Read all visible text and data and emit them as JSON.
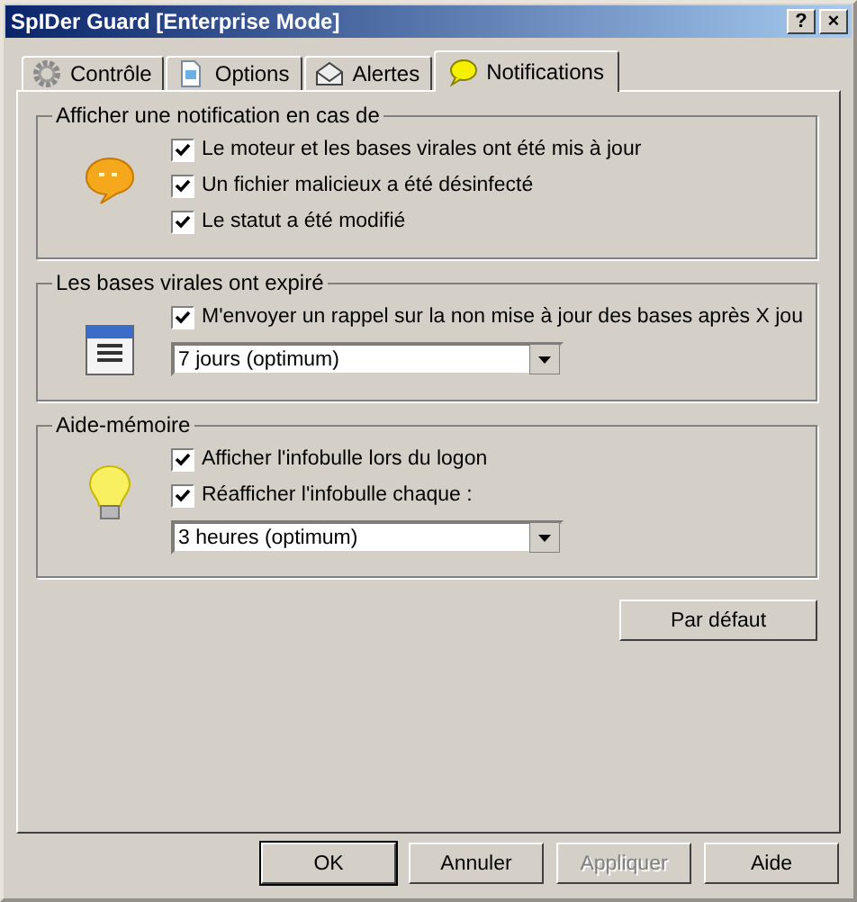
{
  "window": {
    "title": "SpIDer Guard [Enterprise Mode]",
    "help_button": "?",
    "close_button": "×"
  },
  "tabs": [
    {
      "label": "Contrôle",
      "selected": false
    },
    {
      "label": "Options",
      "selected": false
    },
    {
      "label": "Alertes",
      "selected": false
    },
    {
      "label": "Notifications",
      "selected": true
    }
  ],
  "groups": [
    {
      "title": "Afficher une notification en cas de",
      "items": [
        {
          "kind": "checkbox",
          "label": "Le moteur et les bases virales ont été mis à jour",
          "checked": true
        },
        {
          "kind": "checkbox",
          "label": "Un fichier malicieux a été désinfecté",
          "checked": true
        },
        {
          "kind": "checkbox",
          "label": "Le statut a été modifié",
          "checked": true
        }
      ]
    },
    {
      "title": "Les bases virales ont expiré",
      "items": [
        {
          "kind": "checkbox",
          "label": "M'envoyer un rappel sur la non mise à jour des bases après X jou",
          "checked": true
        },
        {
          "kind": "dropdown",
          "value": "7 jours (optimum)"
        }
      ]
    },
    {
      "title": "Aide-mémoire",
      "items": [
        {
          "kind": "checkbox",
          "label": "Afficher l'infobulle lors du logon",
          "checked": true
        },
        {
          "kind": "checkbox",
          "label": "Réafficher l'infobulle chaque :",
          "checked": true
        },
        {
          "kind": "dropdown",
          "value": "3 heures (optimum)"
        }
      ]
    }
  ],
  "default_button": "Par défaut",
  "buttons": [
    {
      "label": "OK",
      "default": true,
      "disabled": false
    },
    {
      "label": "Annuler",
      "default": false,
      "disabled": false
    },
    {
      "label": "Appliquer",
      "default": false,
      "disabled": true
    },
    {
      "label": "Aide",
      "default": false,
      "disabled": false
    }
  ]
}
